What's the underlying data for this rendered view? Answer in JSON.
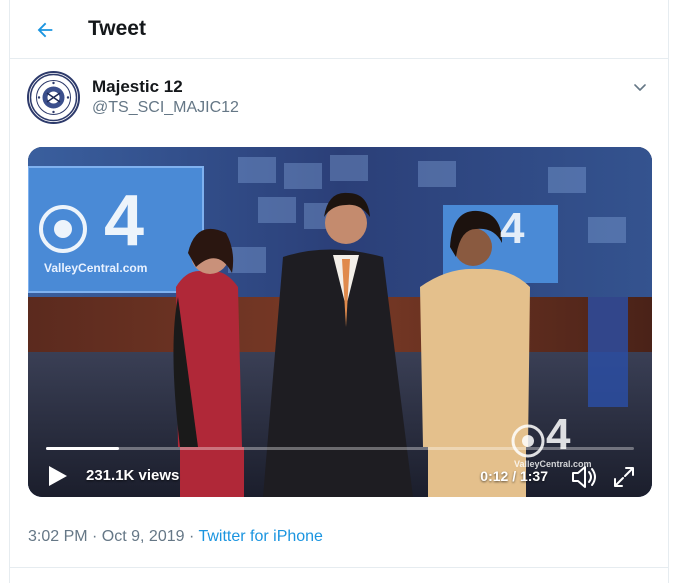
{
  "header": {
    "title": "Tweet"
  },
  "tweet": {
    "display_name": "Majestic 12",
    "handle": "@TS_SCI_MAJIC12",
    "timestamp": "3:02 PM · Oct 9, 2019 · ",
    "source": "Twitter for iPhone"
  },
  "video": {
    "views": "231.1K views",
    "time": "0:12 / 1:37",
    "progress": 0.124,
    "channel_logo_text": "4",
    "channel_site": "ValleyCentral.com"
  },
  "colors": {
    "accent": "#1b95e0",
    "secondary_text": "#657786",
    "border": "#e6ecf0"
  }
}
